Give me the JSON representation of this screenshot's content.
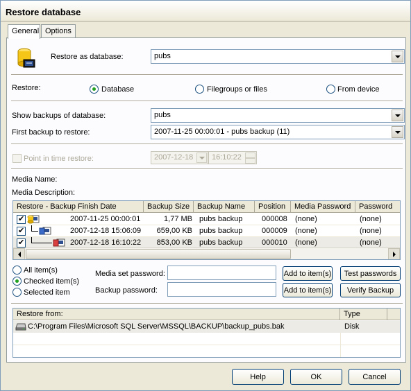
{
  "window": {
    "title": "Restore database"
  },
  "tabs": [
    {
      "label": "General"
    },
    {
      "label": "Options"
    }
  ],
  "restore_as": {
    "label": "Restore as database:",
    "value": "pubs"
  },
  "restore": {
    "label": "Restore:",
    "options": [
      {
        "label": "Database",
        "selected": true
      },
      {
        "label": "Filegroups or files",
        "selected": false
      },
      {
        "label": "From device",
        "selected": false
      }
    ]
  },
  "show_backups": {
    "label": "Show backups of database:",
    "value": "pubs"
  },
  "first_backup": {
    "label": "First backup to restore:",
    "value": "2007-11-25 00:00:01 - pubs backup (11)"
  },
  "point_in_time": {
    "label": "Point in time restore:",
    "date": "2007-12-18",
    "time": "16:10:22"
  },
  "media": {
    "name_label": "Media Name:",
    "description_label": "Media Description:"
  },
  "backup_grid": {
    "columns": [
      "Restore - Backup Finish Date",
      "Backup Size",
      "Backup Name",
      "Position",
      "Media Password",
      "Password"
    ],
    "rows": [
      {
        "date": "2007-11-25 00:00:01",
        "size": "1,77 MB",
        "name": "pubs backup",
        "position": "000008",
        "media_password": "(none)",
        "password": "(none)"
      },
      {
        "date": "2007-12-18 15:06:09",
        "size": "659,00 KB",
        "name": "pubs backup",
        "position": "000009",
        "media_password": "(none)",
        "password": "(none)"
      },
      {
        "date": "2007-12-18 16:10:22",
        "size": "853,00 KB",
        "name": "pubs backup",
        "position": "000010",
        "media_password": "(none)",
        "password": "(none)"
      }
    ]
  },
  "scope": {
    "options": [
      {
        "label": "All item(s)",
        "selected": false
      },
      {
        "label": "Checked item(s)",
        "selected": true
      },
      {
        "label": "Selected item",
        "selected": false
      }
    ]
  },
  "passwords": {
    "media_set_label": "Media set password:",
    "backup_label": "Backup password:",
    "add_to_items_label": "Add to item(s)",
    "test_passwords_label": "Test passwords",
    "verify_backup_label": "Verify Backup"
  },
  "restore_from_grid": {
    "columns": [
      "Restore from:",
      "Type"
    ],
    "rows": [
      {
        "path": "C:\\Program Files\\Microsoft SQL Server\\MSSQL\\BACKUP\\backup_pubs.bak",
        "type": "Disk"
      }
    ]
  },
  "footer": {
    "help_label": "Help",
    "ok_label": "OK",
    "cancel_label": "Cancel"
  }
}
